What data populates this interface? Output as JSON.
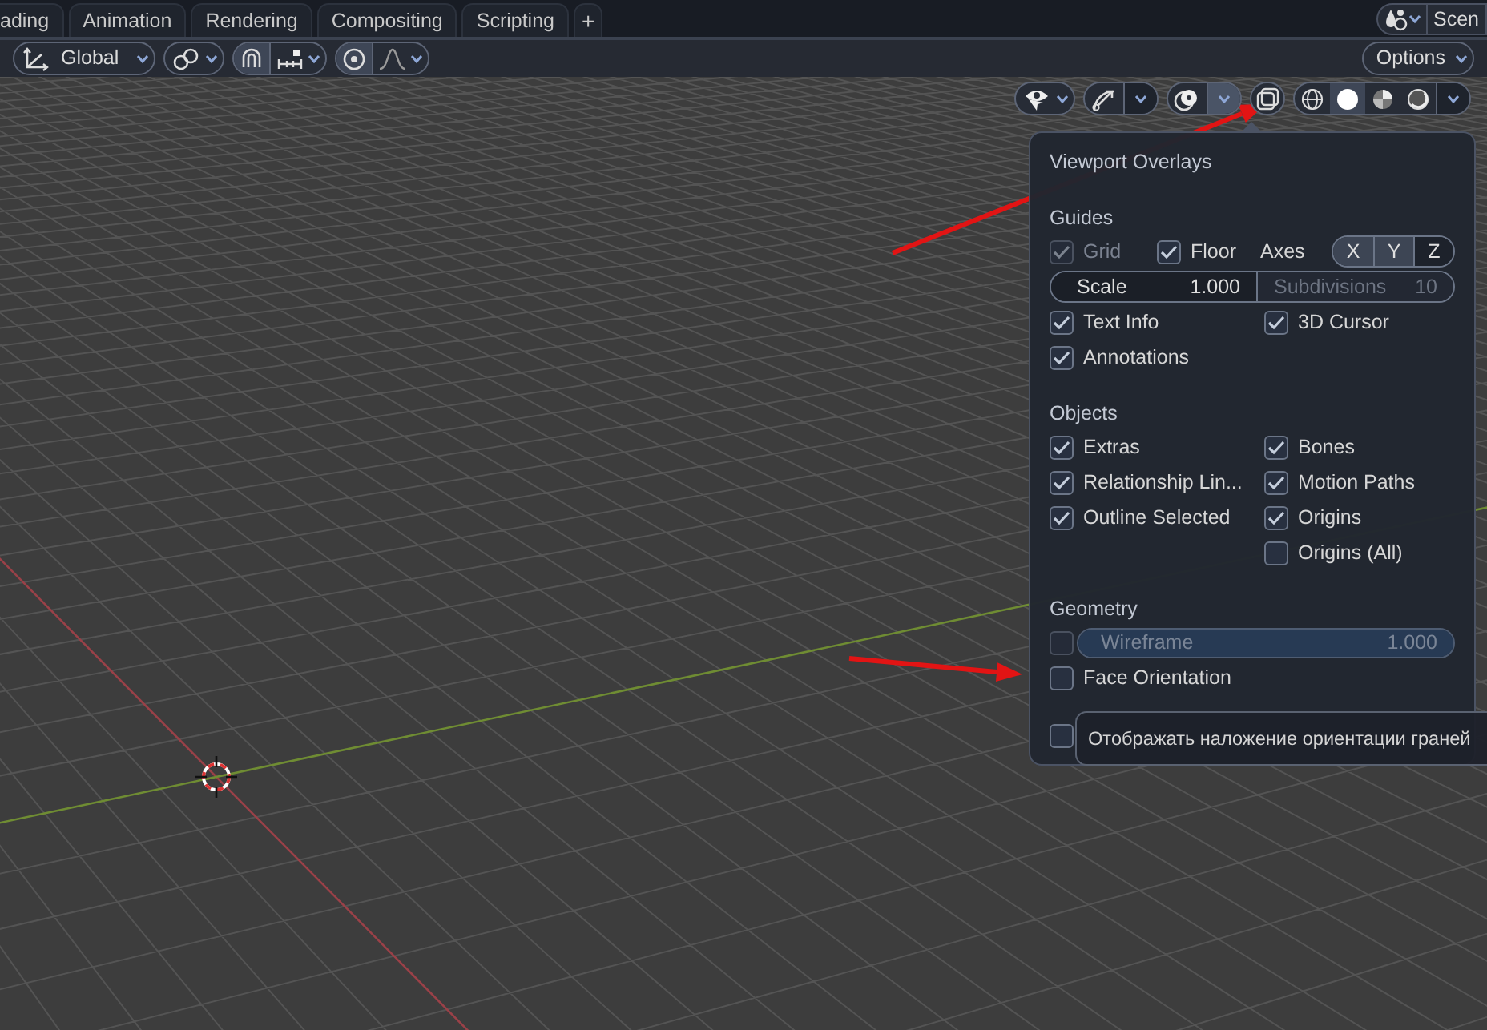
{
  "workspace_tabs": [
    {
      "label": "ading",
      "selected": false
    },
    {
      "label": "Animation",
      "selected": false
    },
    {
      "label": "Rendering",
      "selected": false
    },
    {
      "label": "Compositing",
      "selected": false
    },
    {
      "label": "Scripting",
      "selected": false
    }
  ],
  "add_tab": "+",
  "scene": {
    "label": "Scen"
  },
  "toolbar": {
    "orientation": "Global",
    "options": "Options"
  },
  "shading_modes": [
    {
      "kind": "wireframe",
      "selected": false
    },
    {
      "kind": "solid",
      "selected": true
    },
    {
      "kind": "material",
      "selected": false
    },
    {
      "kind": "rendered",
      "selected": false
    }
  ],
  "overlays_panel": {
    "title": "Viewport Overlays",
    "guides": {
      "heading": "Guides",
      "grid": {
        "label": "Grid",
        "checked": true,
        "disabled": true
      },
      "floor": {
        "label": "Floor",
        "checked": true
      },
      "axes_label": "Axes",
      "axes": [
        {
          "label": "X",
          "selected": true
        },
        {
          "label": "Y",
          "selected": true
        },
        {
          "label": "Z",
          "selected": false
        }
      ],
      "scale": {
        "label": "Scale",
        "value": "1.000"
      },
      "subdivisions": {
        "label": "Subdivisions",
        "value": "10",
        "disabled": true
      },
      "left_column": [
        {
          "label": "Text Info",
          "checked": true
        },
        {
          "label": "Annotations",
          "checked": true
        }
      ],
      "right_column": [
        {
          "label": "3D Cursor",
          "checked": true
        }
      ]
    },
    "objects": {
      "heading": "Objects",
      "left_column": [
        {
          "label": "Extras",
          "checked": true
        },
        {
          "label": "Relationship Lin...",
          "checked": true
        },
        {
          "label": "Outline Selected",
          "checked": true
        }
      ],
      "right_column": [
        {
          "label": "Bones",
          "checked": true
        },
        {
          "label": "Motion Paths",
          "checked": true
        },
        {
          "label": "Origins",
          "checked": true
        },
        {
          "label": "Origins (All)",
          "checked": false
        }
      ]
    },
    "geometry": {
      "heading": "Geometry",
      "wireframe": {
        "checked": false,
        "label": "Wireframe",
        "value": "1.000",
        "level": 1,
        "disabled": true
      },
      "options": [
        {
          "label": "Face Orientation",
          "checked": false
        },
        {
          "checked": false
        }
      ]
    }
  },
  "tooltip": {
    "text": "Отображать наложение ориентации граней"
  }
}
